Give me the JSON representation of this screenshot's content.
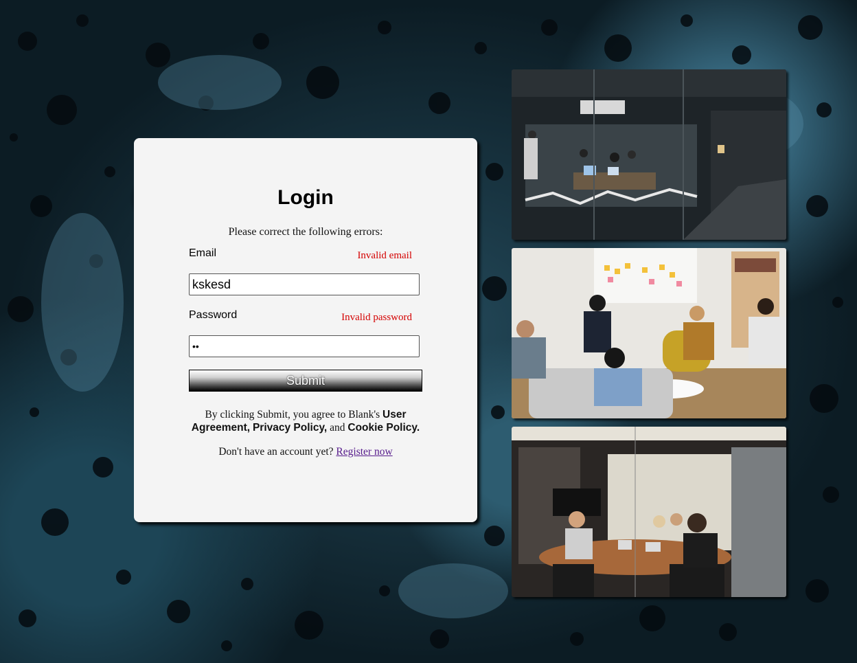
{
  "login": {
    "title": "Login",
    "error_summary": "Please correct the following errors:",
    "email": {
      "label": "Email",
      "error": "Invalid email",
      "value": "kskesd"
    },
    "password": {
      "label": "Password",
      "error": "Invalid password",
      "value": "••"
    },
    "submit_label": "Submit",
    "agreement": {
      "prefix": "By clicking Submit, you agree to Blank's ",
      "user_agreement": "User Agreement,",
      "privacy_policy": "Privacy Policy,",
      "and": " and ",
      "cookie_policy": "Cookie Policy."
    },
    "register": {
      "prompt": "Don't have an account yet? ",
      "link": "Register now"
    }
  },
  "colors": {
    "error": "#d40000",
    "card_background": "#f4f4f4",
    "link": "#551a8b"
  },
  "photos": [
    {
      "name": "office-glass-meeting-room-photo"
    },
    {
      "name": "office-lounge-team-meeting-photo"
    },
    {
      "name": "office-conference-table-photo"
    }
  ]
}
